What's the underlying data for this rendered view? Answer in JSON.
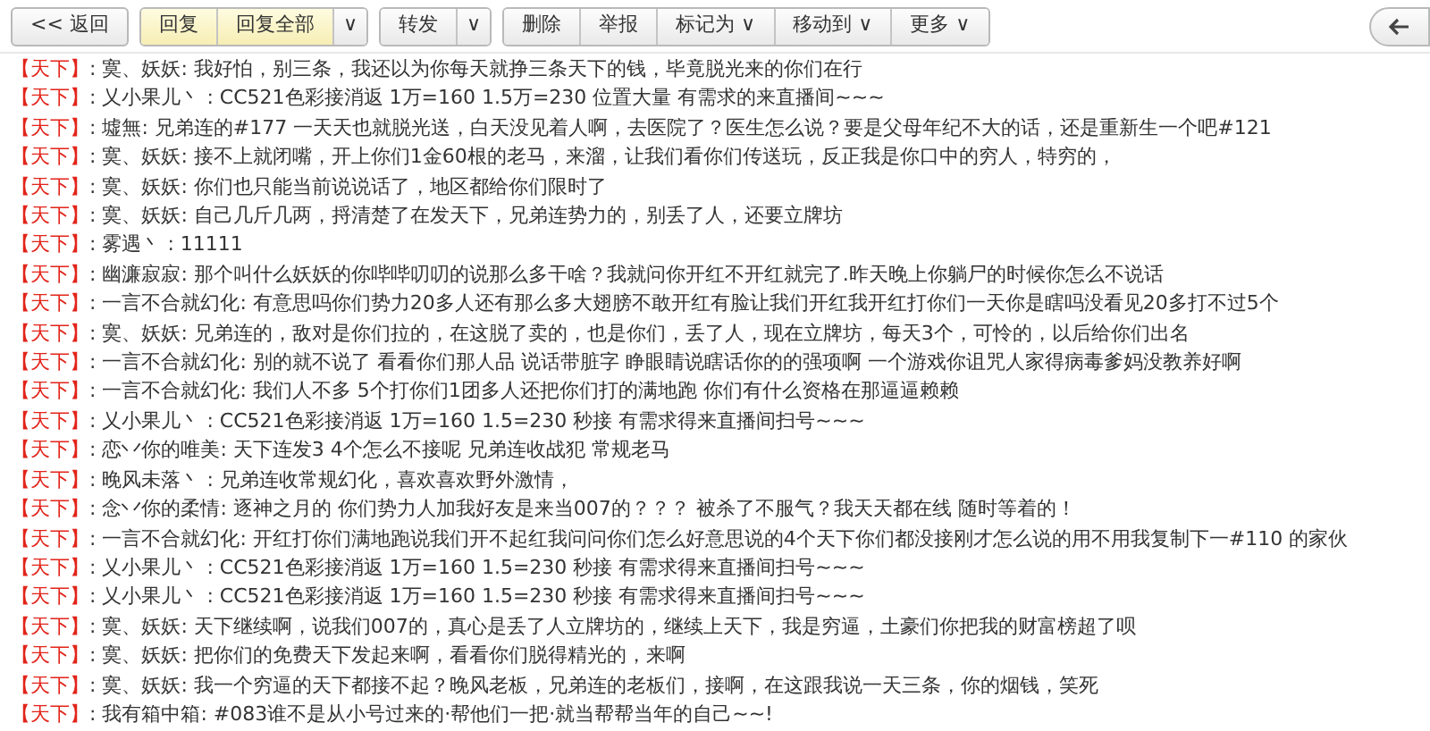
{
  "toolbar": {
    "back": {
      "arrows": "<<",
      "label": "返回"
    },
    "groups": [
      [
        {
          "label": "回复",
          "highlighted": true
        },
        {
          "label": "回复全部",
          "highlighted": true
        },
        {
          "caret": "∨",
          "highlighted": false
        }
      ],
      [
        {
          "label": "转发",
          "highlighted": false
        },
        {
          "caret": "∨",
          "highlighted": false
        }
      ],
      [
        {
          "label": "删除",
          "highlighted": false
        },
        {
          "label": "举报",
          "highlighted": false
        },
        {
          "label": "标记为",
          "caret": "∨",
          "highlighted": false
        },
        {
          "label": "移动到",
          "caret": "∨",
          "highlighted": false
        },
        {
          "label": "更多",
          "caret": "∨",
          "highlighted": false
        }
      ]
    ]
  },
  "messages": [
    {
      "channel": "【天下】",
      "text": ": 寞、妖妖: 我好怕，别三条，我还以为你每天就挣三条天下的钱，毕竟脱光来的你们在行"
    },
    {
      "channel": "【天下】",
      "text": ": 乂小果儿丶 : CC521色彩接消返 1万=160 1.5万=230 位置大量 有需求的来直播间~~~"
    },
    {
      "channel": "【天下】",
      "text": ": 墟無: 兄弟连的#177 一天天也就脱光送，白天没见着人啊，去医院了？医生怎么说？要是父母年纪不大的话，还是重新生一个吧#121"
    },
    {
      "channel": "【天下】",
      "text": ": 寞、妖妖: 接不上就闭嘴，开上你们1金60根的老马，来溜，让我们看你们传送玩，反正我是你口中的穷人，特穷的，"
    },
    {
      "channel": "【天下】",
      "text": ": 寞、妖妖: 你们也只能当前说说话了，地区都给你们限时了"
    },
    {
      "channel": "【天下】",
      "text": ": 寞、妖妖: 自己几斤几两，捋清楚了在发天下，兄弟连势力的，别丢了人，还要立牌坊"
    },
    {
      "channel": "【天下】",
      "text": ": 雾遇丶 : 11111"
    },
    {
      "channel": "【天下】",
      "text": ": 幽濂寂寂: 那个叫什么妖妖的你哔哔叨叨的说那么多干啥？我就问你开红不开红就完了.昨天晚上你躺尸的时候你怎么不说话"
    },
    {
      "channel": "【天下】",
      "text": ": 一言不合就幻化: 有意思吗你们势力20多人还有那么多大翅膀不敢开红有脸让我们开红我开红打你们一天你是瞎吗没看见20多打不过5个"
    },
    {
      "channel": "【天下】",
      "text": ": 寞、妖妖: 兄弟连的，敌对是你们拉的，在这脱了卖的，也是你们，丢了人，现在立牌坊，每天3个，可怜的，以后给你们出名"
    },
    {
      "channel": "【天下】",
      "text": ": 一言不合就幻化: 别的就不说了 看看你们那人品 说话带脏字 睁眼睛说瞎话你的的强项啊 一个游戏你诅咒人家得病毒爹妈没教养好啊"
    },
    {
      "channel": "【天下】",
      "text": ": 一言不合就幻化: 我们人不多 5个打你们1团多人还把你们打的满地跑 你们有什么资格在那逼逼赖赖"
    },
    {
      "channel": "【天下】",
      "text": ": 乂小果儿丶 : CC521色彩接消返 1万=160 1.5=230 秒接 有需求得来直播间扫号~~~"
    },
    {
      "channel": "【天下】",
      "text": ": 恋丷你的唯美: 天下连发3 4个怎么不接呢 兄弟连收战犯 常规老马"
    },
    {
      "channel": "【天下】",
      "text": ": 晚风未落丶 : 兄弟连收常规幻化，喜欢喜欢野外激情，"
    },
    {
      "channel": "【天下】",
      "text": ": 念丷你的柔情: 逐神之月的 你们势力人加我好友是来当007的？？？ 被杀了不服气？我天天都在线 随时等着的！"
    },
    {
      "channel": "【天下】",
      "text": ": 一言不合就幻化: 开红打你们满地跑说我们开不起红我问问你们怎么好意思说的4个天下你们都没接刚才怎么说的用不用我复制下一#110 的家伙"
    },
    {
      "channel": "【天下】",
      "text": ": 乂小果儿丶 : CC521色彩接消返 1万=160 1.5=230 秒接 有需求得来直播间扫号~~~"
    },
    {
      "channel": "【天下】",
      "text": ": 乂小果儿丶 : CC521色彩接消返 1万=160 1.5=230 秒接 有需求得来直播间扫号~~~"
    },
    {
      "channel": "【天下】",
      "text": ": 寞、妖妖: 天下继续啊，说我们007的，真心是丢了人立牌坊的，继续上天下，我是穷逼，土豪们你把我的财富榜超了呗"
    },
    {
      "channel": "【天下】",
      "text": ": 寞、妖妖: 把你们的免费天下发起来啊，看看你们脱得精光的，来啊"
    },
    {
      "channel": "【天下】",
      "text": ": 寞、妖妖: 我一个穷逼的天下都接不起？晚风老板，兄弟连的老板们，接啊，在这跟我说一天三条，你的烟钱，笑死"
    },
    {
      "channel": "【天下】",
      "text": ": 我有箱中箱: #083谁不是从小号过来的·帮他们一把·就当帮帮当年的自己~~!"
    }
  ]
}
